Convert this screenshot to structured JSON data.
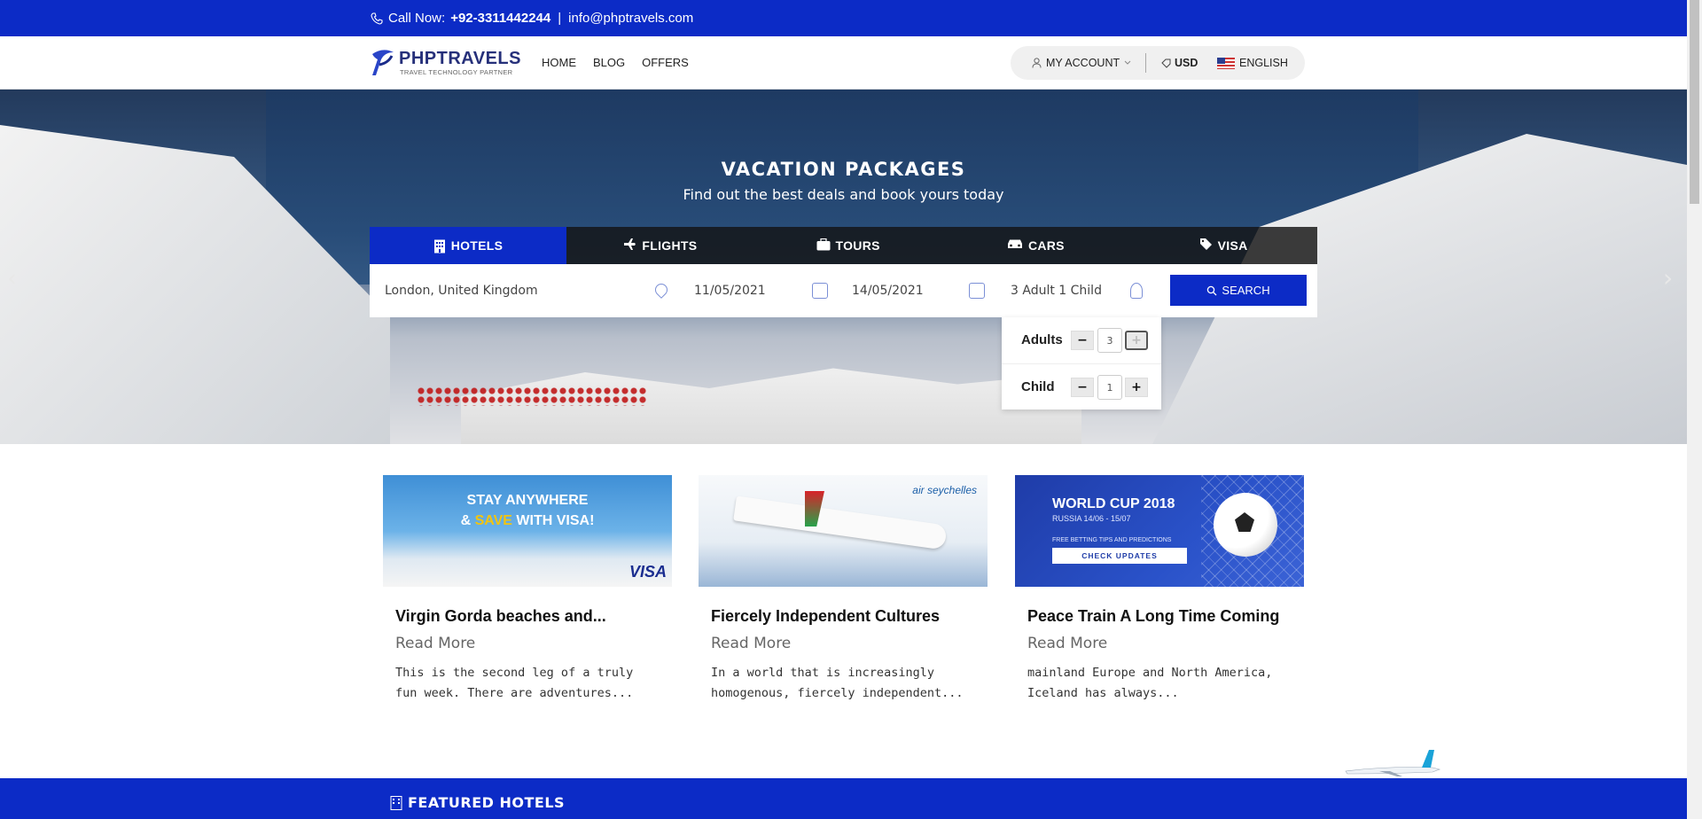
{
  "topbar": {
    "call_label": "Call Now:",
    "phone": "+92-3311442244",
    "divider": "|",
    "email": "info@phptravels.com"
  },
  "header": {
    "brand": "PHPTRAVELS",
    "tagline": "TRAVEL TECHNOLOGY PARTNER",
    "nav": [
      {
        "label": "HOME"
      },
      {
        "label": "BLOG"
      },
      {
        "label": "OFFERS"
      }
    ],
    "account_label": "MY ACCOUNT",
    "currency": "USD",
    "language": "ENGLISH"
  },
  "hero": {
    "title": "VACATION PACKAGES",
    "subtitle": "Find out the best deals and book yours today"
  },
  "tabs": [
    {
      "label": "HOTELS",
      "icon": "building-icon",
      "active": true
    },
    {
      "label": "FLIGHTS",
      "icon": "plane-icon",
      "active": false
    },
    {
      "label": "TOURS",
      "icon": "suitcase-icon",
      "active": false
    },
    {
      "label": "CARS",
      "icon": "car-icon",
      "active": false
    },
    {
      "label": "VISA",
      "icon": "tag-icon",
      "active": false
    }
  ],
  "search": {
    "destination": "London, United Kingdom",
    "checkin": "11/05/2021",
    "checkout": "14/05/2021",
    "guests": "3 Adult 1 Child",
    "button": "SEARCH"
  },
  "guests_panel": {
    "adults_label": "Adults",
    "adults_value": "3",
    "child_label": "Child",
    "child_value": "1",
    "minus": "−",
    "plus": "+"
  },
  "cards": [
    {
      "banner_line1": "STAY ANYWHERE",
      "banner_line2_a": "& ",
      "banner_line2_b": "SAVE",
      "banner_line2_c": " WITH VISA!",
      "banner_brand": "VISA",
      "title": "Virgin Gorda beaches and...",
      "more": "Read More",
      "desc": "This is the second leg of a truly fun week. There are adventures..."
    },
    {
      "banner_brand": "air seychelles",
      "title": "Fiercely Independent Cultures",
      "more": "Read More",
      "desc": "In a world that is increasingly homogenous, fiercely independent..."
    },
    {
      "banner_line1": "WORLD CUP 2018",
      "banner_line2": "RUSSIA 14/06 - 15/07",
      "banner_line3": "FREE BETTING TIPS AND PREDICTIONS",
      "banner_cta": "CHECK UPDATES",
      "title": "Peace Train A Long Time Coming",
      "more": "Read More",
      "desc": " mainland Europe and North America, Iceland has always..."
    }
  ],
  "featured": {
    "title": "FEATURED HOTELS"
  },
  "colors": {
    "brand_blue": "#0c2bc6",
    "dark_tabs": "#1c1c1c"
  }
}
